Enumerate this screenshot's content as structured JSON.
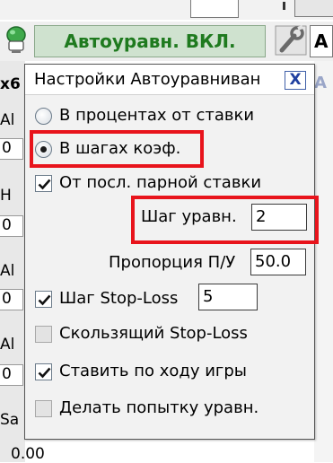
{
  "toolbar": {
    "auto_label": "Автоуравн. ВКЛ.",
    "right_stub": "A"
  },
  "background": {
    "labels": [
      "x6",
      "Al",
      "0",
      "H",
      "0",
      "Al",
      "0",
      "Al",
      "0",
      "Sa"
    ],
    "bottom_value": "0.00",
    "right_a": "A"
  },
  "popup": {
    "title": "Настройки Автоуравниван",
    "close_label": "X",
    "options": {
      "percent_label": "В процентах от ставки",
      "steps_label": "В шагах коэф.",
      "from_last_pair_label": "От посл. парной ставки",
      "step_label": "Шаг уравн.",
      "step_value": "2",
      "ratio_label": "Пропорция П/У",
      "ratio_value": "50.0",
      "stoploss_step_label": "Шаг Stop-Loss",
      "stoploss_step_value": "5",
      "trailing_stoploss_label": "Скользящий Stop-Loss",
      "place_during_game_label": "Ставить по ходу игры",
      "try_equalize_label": "Делать попытку уравн."
    }
  },
  "state": {
    "mode": "steps",
    "from_last_pair": true,
    "stoploss_step": true,
    "trailing_stoploss": false,
    "place_during_game": true,
    "try_equalize": false
  },
  "colors": {
    "highlight": "#e8141c",
    "auto_text": "#1f7a1f",
    "close": "#2040a0"
  }
}
